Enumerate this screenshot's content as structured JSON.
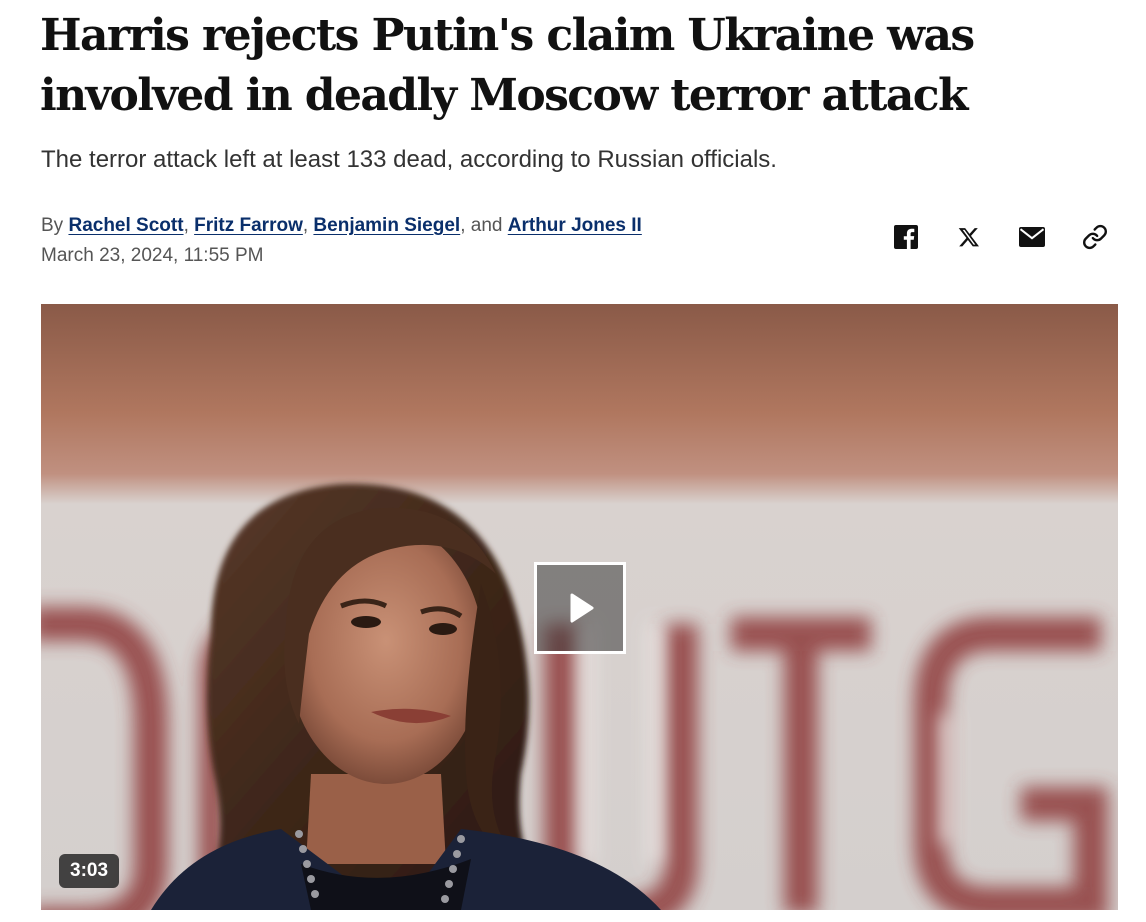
{
  "article": {
    "headline": "Harris rejects Putin's claim Ukraine was involved in deadly Moscow terror attack",
    "dek": "The terror attack left at least 133 dead, according to Russian officials.",
    "byline": {
      "prefix": "By",
      "authors": [
        "Rachel Scott",
        "Fritz Farrow",
        "Benjamin Siegel",
        "Arthur Jones II"
      ],
      "separator": ",",
      "conjunction": ", and"
    },
    "timestamp": "March 23, 2024, 11:55 PM"
  },
  "share": {
    "icons": [
      "facebook-icon",
      "x-icon",
      "email-icon",
      "link-icon"
    ]
  },
  "video": {
    "duration": "3:03",
    "play_icon": "play-icon"
  },
  "colors": {
    "headline": "#111111",
    "author_link": "#0a2f6b",
    "meta_text": "#555555",
    "icon": "#111111"
  }
}
